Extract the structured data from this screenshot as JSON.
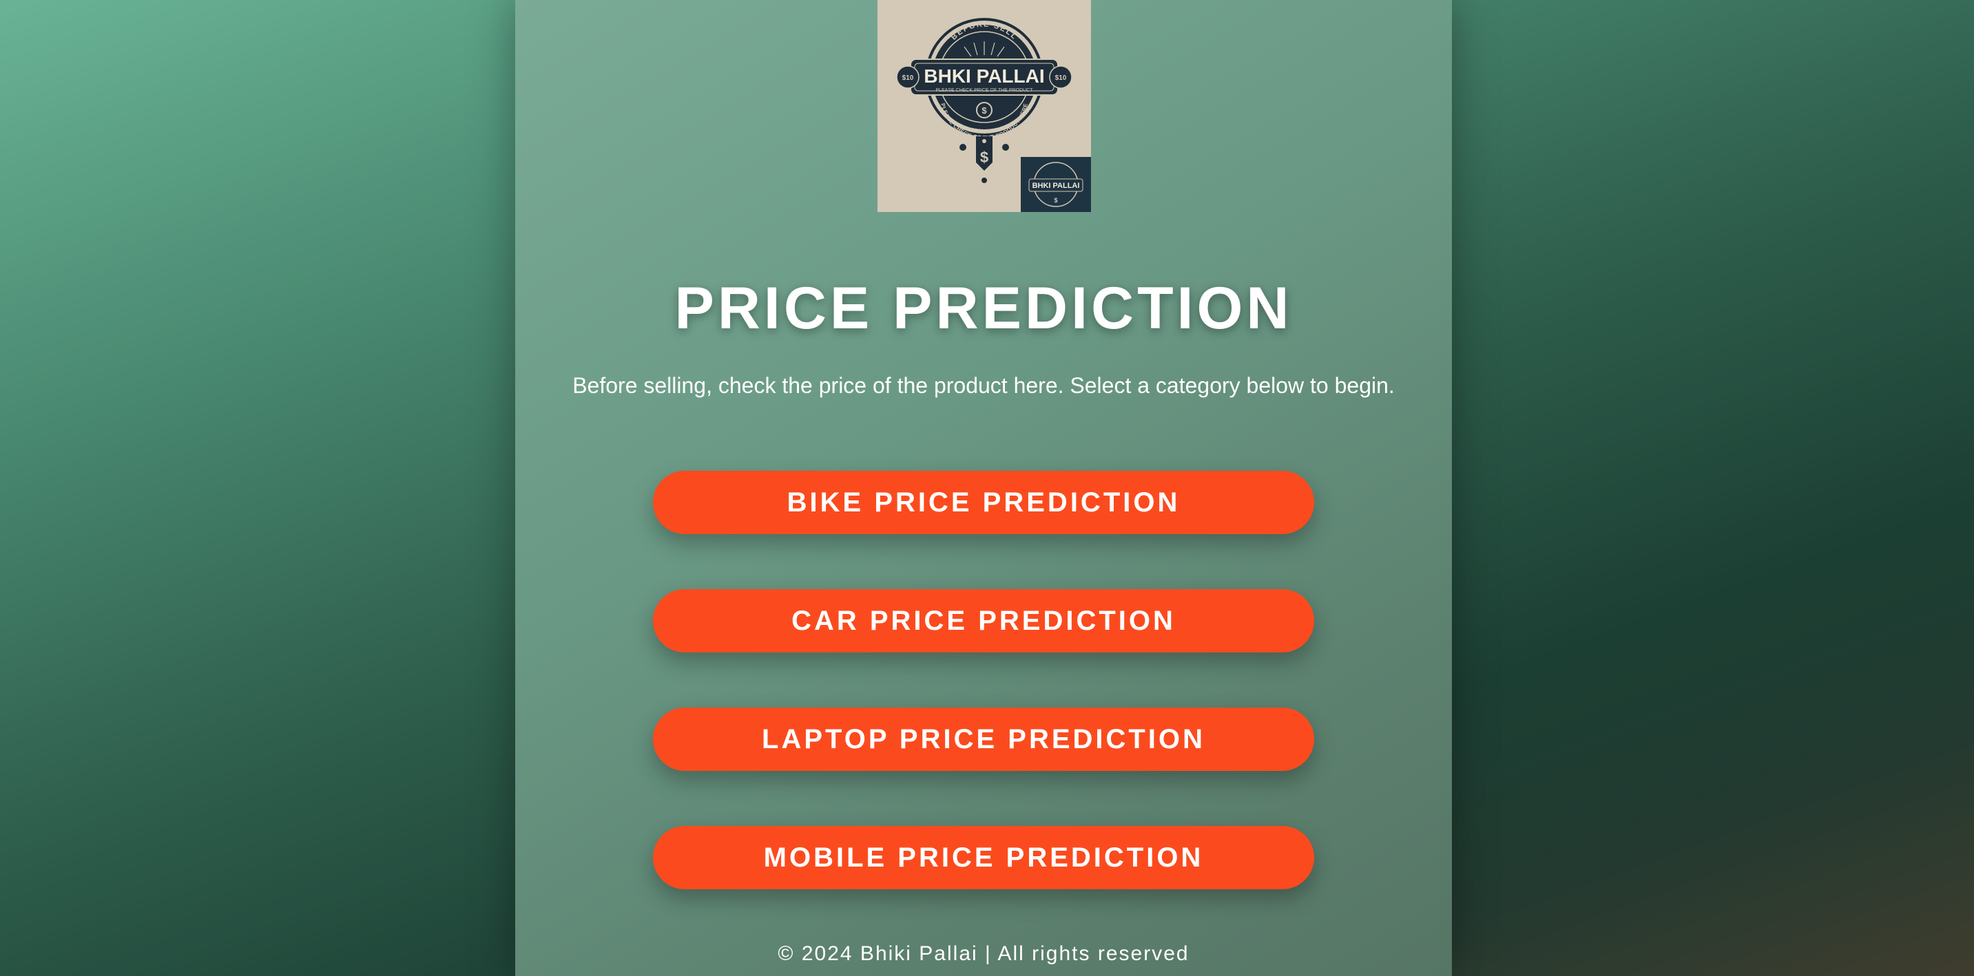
{
  "logo": {
    "arc_top": "BEFORE SELL",
    "brand": "BHKI PALLAI",
    "tagline": "PLEASE CHECK PRICE OF THE PRODUCT",
    "arc_bottom": "PLEASE CHECK OF THE PRODUCT HERE",
    "left_badge": "$10",
    "right_badge": "$10",
    "small_brand": "BHKI PALLAI"
  },
  "header": {
    "title": "PRICE PREDICTION",
    "subtitle": "Before selling, check the price of the product here. Select a category below to begin."
  },
  "buttons": [
    {
      "label": "BIKE PRICE PREDICTION"
    },
    {
      "label": "CAR PRICE PREDICTION"
    },
    {
      "label": "LAPTOP PRICE PREDICTION"
    },
    {
      "label": "MOBILE PRICE PREDICTION"
    }
  ],
  "footer": {
    "text": "© 2024 Bhiki Pallai | All rights reserved"
  },
  "colors": {
    "button": "#fb4b1e",
    "panel": "#6a9a86",
    "text": "#ffffff",
    "logo_background": "#d3c9b6",
    "logo_ink": "#1f2e3a"
  }
}
